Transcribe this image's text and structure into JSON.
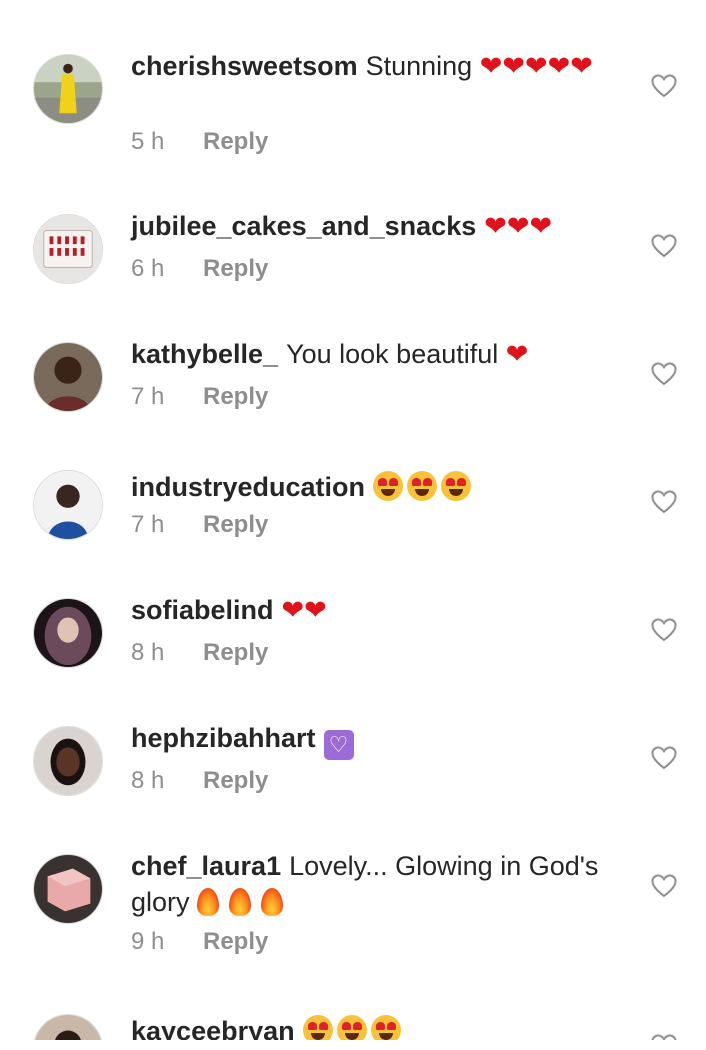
{
  "comments": [
    {
      "username": "cherishsweetsom",
      "text": "Stunning",
      "emoji": "❤❤❤❤❤",
      "time": "5 h",
      "reply": "Reply",
      "avatar": "woman-in-yellow-dress-avatar"
    },
    {
      "username": "jubilee_cakes_and_snacks",
      "text": "",
      "emoji": "❤❤❤",
      "time": "6 h",
      "reply": "Reply",
      "avatar": "cake-avatar"
    },
    {
      "username": "kathybelle_",
      "text": "You look beautiful",
      "emoji": "❤",
      "time": "7 h",
      "reply": "Reply",
      "avatar": "woman-portrait-avatar"
    },
    {
      "username": "industryeducation",
      "text": "",
      "emoji": "heart-eyes x3",
      "time": "7 h",
      "reply": "Reply",
      "avatar": "woman-in-blue-avatar"
    },
    {
      "username": "sofiabelind",
      "text": "",
      "emoji": "❤❤",
      "time": "8 h",
      "reply": "Reply",
      "avatar": "woman-curly-hair-avatar"
    },
    {
      "username": "hephzibahhart",
      "text": "",
      "emoji": "white-heart-purple-square",
      "time": "8 h",
      "reply": "Reply",
      "avatar": "woman-smiling-avatar"
    },
    {
      "username": "chef_laura1",
      "text": "Lovely... Glowing in God's glory",
      "emoji": "fire x3",
      "time": "9 h",
      "reply": "Reply",
      "avatar": "pink-cake-avatar"
    },
    {
      "username": "kayceebryan",
      "text": "",
      "emoji": "heart-eyes x3",
      "time": "",
      "reply": "",
      "avatar": "woman-avatar"
    }
  ],
  "icons": {
    "like": "heart-outline-icon"
  },
  "colors": {
    "username": "#262626",
    "meta": "#8e8e8e",
    "red_heart": "#e0131a"
  }
}
